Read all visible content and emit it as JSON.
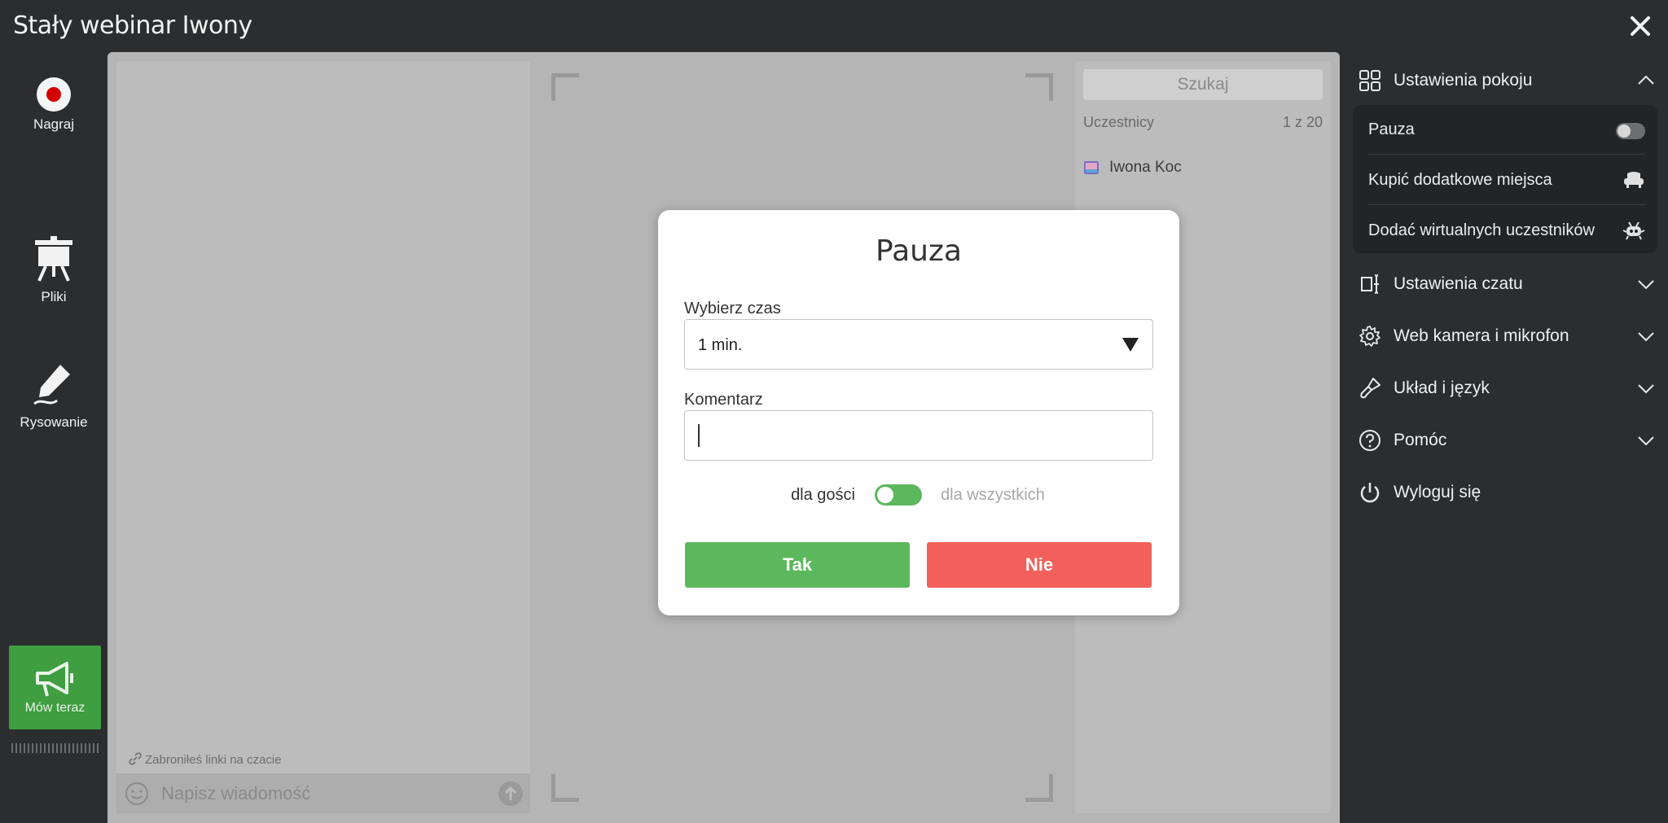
{
  "window": {
    "title": "Stały webinar Iwony"
  },
  "left_toolbar": {
    "record": "Nagraj",
    "files": "Pliki",
    "drawing": "Rysowanie",
    "speak_now": "Mów teraz"
  },
  "chat": {
    "notice": "Zabroniłeś linki na czacie",
    "input_placeholder": "Napisz wiadomość"
  },
  "participants": {
    "search_label": "Szukaj",
    "header": "Uczestnicy",
    "count": "1 z 20",
    "list": [
      {
        "name": "Iwona Koc"
      }
    ]
  },
  "right_menu": {
    "room_settings": {
      "label": "Ustawienia pokoju",
      "items": [
        {
          "label": "Pauza",
          "toggle": false
        },
        {
          "label": "Kupić dodatkowe miejsca",
          "icon": "armchair-icon"
        },
        {
          "label": "Dodać wirtualnych uczestników",
          "icon": "robot-icon"
        }
      ]
    },
    "chat_settings": "Ustawienia czatu",
    "webcam": "Web kamera i mikrofon",
    "layout_language": "Układ i język",
    "help": "Pomóc",
    "logout": "Wyloguj się"
  },
  "dialog": {
    "title": "Pauza",
    "time_label": "Wybierz czas",
    "time_value": "1 min.",
    "comment_label": "Komentarz",
    "comment_value": "",
    "audience_left": "dla gości",
    "audience_right": "dla wszystkich",
    "yes": "Tak",
    "no": "Nie"
  },
  "colors": {
    "green": "#5cb85c",
    "red": "#f1605a",
    "dark_bg": "#2b2d2f"
  }
}
